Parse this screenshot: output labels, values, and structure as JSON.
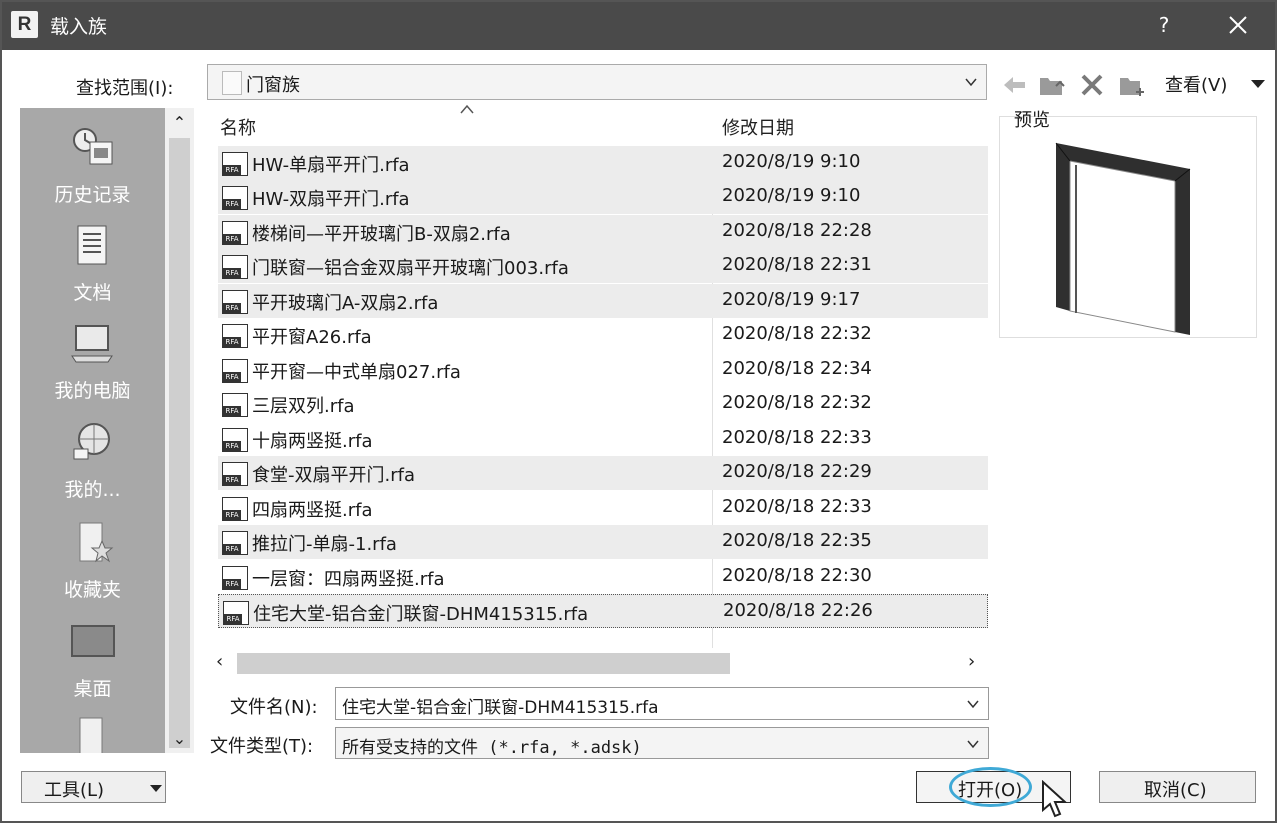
{
  "window": {
    "title": "载入族",
    "app_logo": "R",
    "help": "?"
  },
  "toolbar": {
    "lookin_label": "查找范围(I):",
    "lookin_value": "门窗族",
    "view_label": "查看(V)",
    "icons": [
      "back-icon",
      "up-folder-icon",
      "delete-icon",
      "new-folder-icon"
    ]
  },
  "places": [
    {
      "label": "历史记录",
      "icon": "history-icon"
    },
    {
      "label": "文档",
      "icon": "documents-icon"
    },
    {
      "label": "我的电脑",
      "icon": "computer-icon"
    },
    {
      "label": "我的...",
      "icon": "network-icon"
    },
    {
      "label": "收藏夹",
      "icon": "favorites-icon"
    },
    {
      "label": "桌面",
      "icon": "desktop-icon"
    }
  ],
  "filelist": {
    "columns": {
      "name": "名称",
      "date": "修改日期"
    },
    "rows": [
      {
        "name": "HW-单扇平开门.rfa",
        "date": "2020/8/19 9:10"
      },
      {
        "name": "HW-双扇平开门.rfa",
        "date": "2020/8/19 9:10"
      },
      {
        "name": "楼梯间—平开玻璃门B-双扇2.rfa",
        "date": "2020/8/18 22:28"
      },
      {
        "name": "门联窗—铝合金双扇平开玻璃门003.rfa",
        "date": "2020/8/18 22:31"
      },
      {
        "name": "平开玻璃门A-双扇2.rfa",
        "date": "2020/8/19 9:17"
      },
      {
        "name": "平开窗A26.rfa",
        "date": "2020/8/18 22:32"
      },
      {
        "name": "平开窗—中式单扇027.rfa",
        "date": "2020/8/18 22:34"
      },
      {
        "name": "三层双列.rfa",
        "date": "2020/8/18 22:32"
      },
      {
        "name": "十扇两竖挺.rfa",
        "date": "2020/8/18 22:33"
      },
      {
        "name": "食堂-双扇平开门.rfa",
        "date": "2020/8/18 22:29"
      },
      {
        "name": "四扇两竖挺.rfa",
        "date": "2020/8/18 22:33"
      },
      {
        "name": "推拉门-单扇-1.rfa",
        "date": "2020/8/18 22:35"
      },
      {
        "name": "一层窗：四扇两竖挺.rfa",
        "date": "2020/8/18 22:30"
      },
      {
        "name": "住宅大堂-铝合金门联窗-DHM415315.rfa",
        "date": "2020/8/18 22:26"
      }
    ]
  },
  "preview": {
    "label": "预览"
  },
  "form": {
    "filename_label": "文件名(N):",
    "filename_value": "住宅大堂-铝合金门联窗-DHM415315.rfa",
    "filetype_label": "文件类型(T):",
    "filetype_value": "所有受支持的文件 (*.rfa, *.adsk)"
  },
  "buttons": {
    "tools": "工具(L)",
    "open": "打开(O)",
    "cancel": "取消(C)"
  },
  "colors": {
    "titlebar": "#4a4a4a",
    "places_bg": "#a8a8a8",
    "highlight_ring": "#3fa9d6"
  }
}
